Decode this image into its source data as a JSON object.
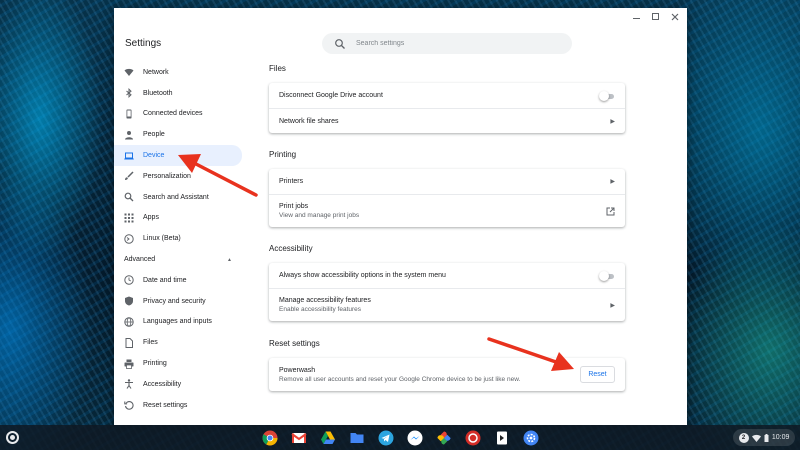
{
  "window": {
    "title": "Settings",
    "search_placeholder": "Search settings"
  },
  "sidebar": {
    "items": [
      {
        "label": "Network",
        "icon": "wifi-icon"
      },
      {
        "label": "Bluetooth",
        "icon": "bluetooth-icon"
      },
      {
        "label": "Connected devices",
        "icon": "phone-icon"
      },
      {
        "label": "People",
        "icon": "person-icon"
      },
      {
        "label": "Device",
        "icon": "laptop-icon",
        "active": true
      },
      {
        "label": "Personalization",
        "icon": "brush-icon"
      },
      {
        "label": "Search and Assistant",
        "icon": "search-icon"
      },
      {
        "label": "Apps",
        "icon": "apps-grid-icon"
      },
      {
        "label": "Linux (Beta)",
        "icon": "terminal-icon"
      }
    ],
    "advanced_label": "Advanced",
    "advanced_items": [
      {
        "label": "Date and time",
        "icon": "clock-icon"
      },
      {
        "label": "Privacy and security",
        "icon": "shield-icon"
      },
      {
        "label": "Languages and inputs",
        "icon": "globe-icon"
      },
      {
        "label": "Files",
        "icon": "folder-icon"
      },
      {
        "label": "Printing",
        "icon": "printer-icon"
      },
      {
        "label": "Accessibility",
        "icon": "accessibility-icon"
      },
      {
        "label": "Reset settings",
        "icon": "restore-icon"
      }
    ]
  },
  "main": {
    "files": {
      "title": "Files",
      "disconnect_label": "Disconnect Google Drive account",
      "network_shares_label": "Network file shares"
    },
    "printing": {
      "title": "Printing",
      "printers_label": "Printers",
      "print_jobs_label": "Print jobs",
      "print_jobs_sub": "View and manage print jobs"
    },
    "accessibility": {
      "title": "Accessibility",
      "always_show_label": "Always show accessibility options in the system menu",
      "manage_label": "Manage accessibility features",
      "manage_sub": "Enable accessibility features"
    },
    "reset": {
      "title": "Reset settings",
      "powerwash_label": "Powerwash",
      "powerwash_sub": "Remove all user accounts and reset your Google Chrome device to be just like new.",
      "reset_button": "Reset"
    }
  },
  "shelf": {
    "apps": [
      "chrome-icon",
      "gmail-icon",
      "drive-icon",
      "files-icon",
      "telegram-icon",
      "messenger-icon",
      "photos-icon",
      "lastpass-icon",
      "app-icon",
      "settings-icon"
    ],
    "notification_count": "2",
    "time": "10:09"
  }
}
